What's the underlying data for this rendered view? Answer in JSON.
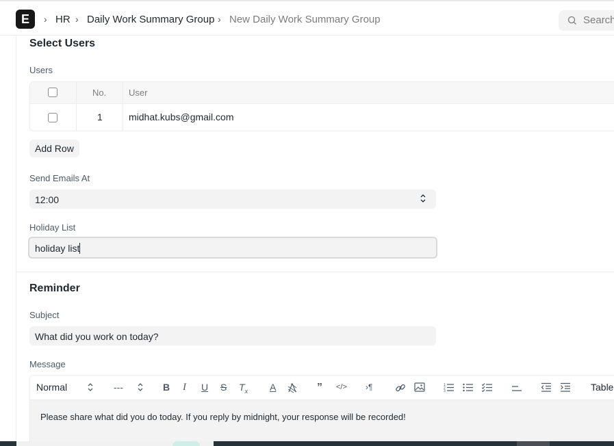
{
  "header": {
    "logo_letter": "E",
    "breadcrumbs": [
      "HR",
      "Daily Work Summary Group",
      "New Daily Work Summary Group"
    ],
    "search_placeholder": "Search"
  },
  "select_users": {
    "title": "Select Users",
    "users_label": "Users",
    "columns": {
      "no": "No.",
      "user": "User"
    },
    "rows": [
      {
        "no": "1",
        "user": "midhat.kubs@gmail.com"
      }
    ],
    "add_row_label": "Add Row"
  },
  "send_emails_at": {
    "label": "Send Emails At",
    "value": "12:00"
  },
  "holiday_list": {
    "label": "Holiday List",
    "value": "holiday list"
  },
  "reminder": {
    "title": "Reminder",
    "subject_label": "Subject",
    "subject_value": "What did you work on today?",
    "message_label": "Message",
    "toolbar": {
      "style_select": "Normal",
      "font_select": "---",
      "table_label": "Table"
    },
    "message_text": "Please share what did you do today. If you reply by midnight, your response will be recorded!"
  }
}
